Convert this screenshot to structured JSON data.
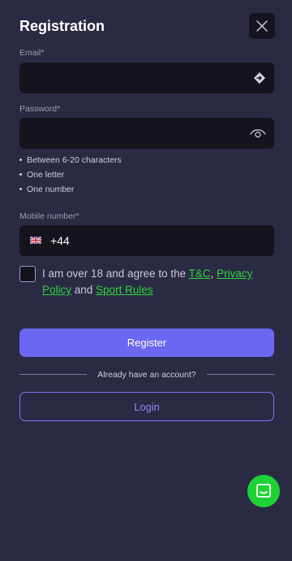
{
  "header": {
    "title": "Registration",
    "close_icon": "close-icon"
  },
  "form": {
    "email": {
      "label": "Email*",
      "value": "",
      "placeholder": "",
      "icon": "autofill-icon"
    },
    "password": {
      "label": "Password*",
      "value": "",
      "placeholder": "",
      "icon": "show-password-eye-icon",
      "rules": [
        "Between 6-20 characters",
        "One letter",
        "One number"
      ]
    },
    "mobile": {
      "label": "Mobile number*",
      "country_flag": "uk-flag-icon",
      "dial_code": "+44",
      "value": ""
    },
    "agreement": {
      "checked": false,
      "text_before": "I am over 18 and agree to the ",
      "tc_link": "T&C",
      "sep1": ", ",
      "privacy_link": "Privacy Policy",
      "sep2": " and ",
      "sport_rules_link": "Sport Rules"
    }
  },
  "actions": {
    "register_label": "Register",
    "divider_text": "Already have an account?",
    "login_label": "Login"
  },
  "chat": {
    "icon": "chat-support-icon"
  },
  "colors": {
    "background": "#2b2a45",
    "field_background": "#15141c",
    "accent": "#6b67f0",
    "link_green": "#2bd63c",
    "chat_green": "#1ed235"
  }
}
